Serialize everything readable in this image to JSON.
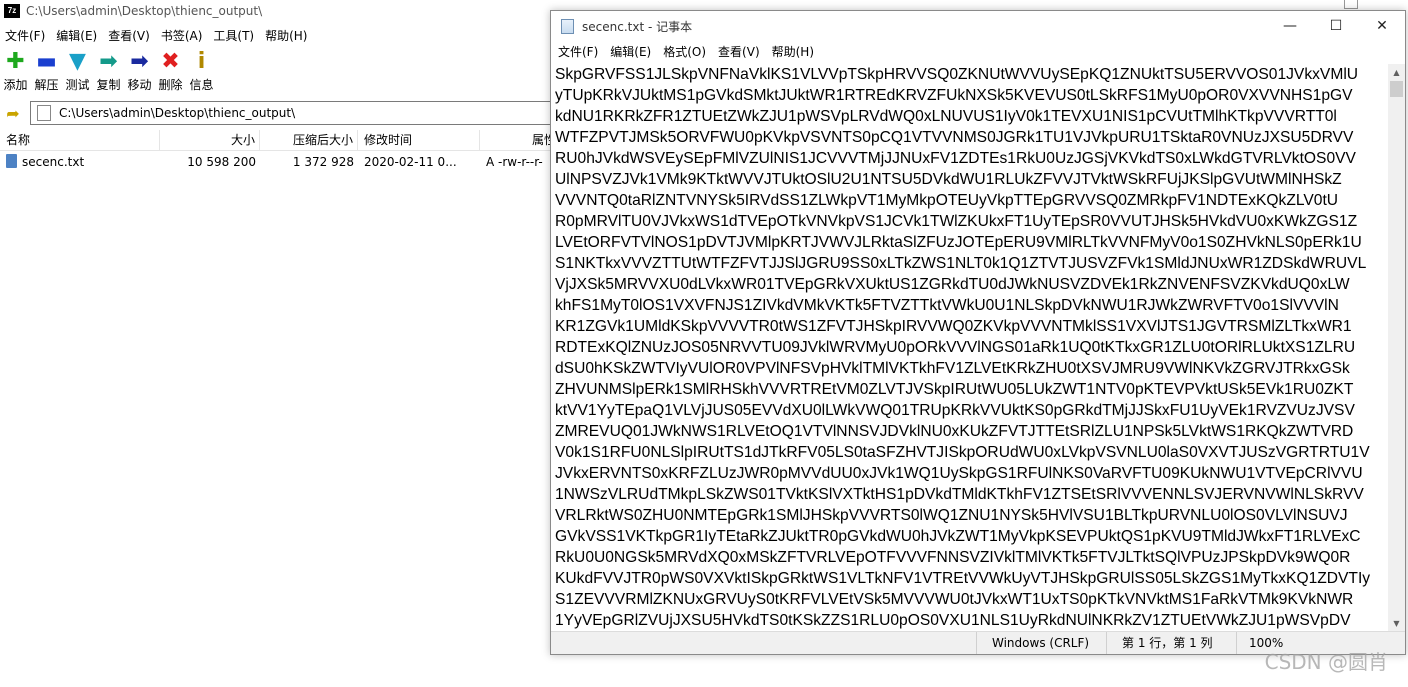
{
  "sevenzip": {
    "title": "C:\\Users\\admin\\Desktop\\thienc_output\\",
    "menu": [
      "文件(F)",
      "编辑(E)",
      "查看(V)",
      "书签(A)",
      "工具(T)",
      "帮助(H)"
    ],
    "toolbar": [
      {
        "label": "添加",
        "icon": "add-icon",
        "glyph": "✚",
        "color": "#1ea81e"
      },
      {
        "label": "解压",
        "icon": "extract-icon",
        "glyph": "▬",
        "color": "#1a3fcf"
      },
      {
        "label": "测试",
        "icon": "test-icon",
        "glyph": "▼",
        "color": "#1aa0c8"
      },
      {
        "label": "复制",
        "icon": "copy-icon",
        "glyph": "➡",
        "color": "#149a8a"
      },
      {
        "label": "移动",
        "icon": "move-icon",
        "glyph": "➡",
        "color": "#1a2a9f"
      },
      {
        "label": "删除",
        "icon": "delete-icon",
        "glyph": "✖",
        "color": "#e02020"
      },
      {
        "label": "信息",
        "icon": "info-icon",
        "glyph": "i",
        "color": "#b08800"
      }
    ],
    "address": "C:\\Users\\admin\\Desktop\\thienc_output\\",
    "columns": [
      "名称",
      "大小",
      "压缩后大小",
      "修改时间",
      "属性"
    ],
    "file": {
      "name": "secenc.txt",
      "size": "10 598 200",
      "packed": "1 372 928",
      "modified": "2020-02-11 0...",
      "attributes": "A -rw-r--r-"
    }
  },
  "notepad": {
    "title": "secenc.txt - 记事本",
    "menu": [
      "文件(F)",
      "编辑(E)",
      "格式(O)",
      "查看(V)",
      "帮助(H)"
    ],
    "lines": [
      "SkpGRVFSS1JLSkpVNFNaVklKS1VLVVpTSkpHRVVSQ0ZKNUtWVVUySEpKQ1ZNUktTSU5ERVVOS01JVkxVMlU",
      "yTUpKRkVJUktMS1pGVkdSMktJUktWR1RTREdKRVZFUkNXSk5KVEVUS0tLSkRFS1MyU0pOR0VXVVNHS1pGV",
      "kdNU1RKRkZFR1ZTUEtZWkZJU1pWSVpLRVdWQ0xLNUVUS1IyV0k1TEVXU1NIS1pCVUtTMlhKTkpVVVRTT0l",
      "WTFZPVTJMSk5ORVFWU0pKVkpVSVNTS0pCQ1VTVVNMS0JGRk1TU1VJVkpURU1TSktaR0VNUzJXSU5DRVV",
      "RU0hJVkdWSVEySEpFMlVZUlNIS1JCVVVTMjJJNUxFV1ZDTEs1RkU0UzJGSjVKVkdTS0xLWkdGTVRLVktOS0VV",
      "UlNPSVZJVk1VMk9KTktWVVJTUktOSlU2U1NTSU5DVkdWU1RLUkZFVVJTVktWSkRFUjJKSlpGVUtWMlNHSkZ",
      "VVVNTQ0taRlZNTVNYSk5IRVdSS1ZLWkpVT1MyMkpOTEUyVkpTTEpGRVVSQ0ZMRkpFV1NDTExKQkZLV0tU",
      "R0pMRVlTU0VJVkxWS1dTVEpOTkVNVkpVS1JCVk1TWlZKUkxFT1UyTEpSR0VVUTJHSk5HVkdVU0xKWkZGS1Z",
      "LVEtORFVTVlNOS1pDVTJVMlpKRTJVWVJLRktaSlZFUzJOTEpERU9VMlRLTkVVNFMyV0o1S0ZHVkNLS0pERk1U",
      "S1NKTkxVVVZTTUtWTFZFVTJJSlJGRU9SS0xLTkZWS1NLT0k1Q1ZTVTJUSVZFVk1SMldJNUxWR1ZDSkdWRUVL",
      "VjJXSk5MRVVXU0dLVkxWR01TVEpGRkVXUktUS1ZGRkdTU0dJWkNUSVZDVEk1RkZNVENFSVZKVkdUQ0xLW",
      "khFS1MyT0lOS1VXVFNJS1ZIVkdVMkVKTk5FTVZTTktVWkU0U1NLSkpDVkNWU1RJWkZWRVFTV0o1SlVVVlN",
      "KR1ZGVk1UMldKSkpVVVVTR0tWS1ZFVTJHSkpIRVVWQ0ZKVkpVVVNTMklSS1VXVlJTS1JGVTRSMlZLTkxWR1",
      "RDTExKQlZNUzJOS05NRVVTU09JVklWRVMyU0pORkVVVlNGS01aRk1UQ0tKTkxGR1ZLU0tORlRLUktXS1ZLRU",
      "dSU0hKSkZWTVIyVUlOR0VPVlNFSVpHVklTMlVKTkhFV1ZLVEtKRkZHU0tXSVJMRU9VWlNKVkZGRVJTRkxGSk",
      "ZHVUNMSlpERk1SMlRHSkhVVVRTREtVM0ZLVTJVSkpIRUtWU05LUkZWT1NTV0pKTEVPVktUSk5EVk1RU0ZKT",
      "ktVV1YyTEpaQ1VLVjJUS05EVVdXU0lLWkVWQ01TRUpKRkVVUktKS0pGRkdTMjJJSkxFU1UyVEk1RVZVUzJVSV",
      "ZMREVUQ01JWkNWS1RLVEtOQ1VTVlNNSVJDVklNU0xKUkZFVTJTTEtSRlZLU1NPSk5LVktWS1RKQkZWTVRD",
      "V0k1S1RFU0NLSlpIRUtTS1dJTkRFV05LS0taSFZHVTJISkpORUdWU0xLVkpVSVNLU0laS0VXVTJUSzVGRTRTU1V",
      "JVkxERVNTS0xKRFZLUzJWR0pMVVdUU0xJVk1WQ1UySkpGS1RFUlNKS0VaRVFTU09KUkNWU1VTVEpCRlVVU",
      "1NWSzVLRUdTMkpLSkZWS01TVktKSlVXTktHS1pDVkdTMldKTkhFV1ZTSEtSRlVVVENNLSVJERVNVWlNLSkRVV",
      "VRLRktWS0ZHU0NMTEpGRk1SMlJHSkpVVVRTS0lWQ1ZNU1NYSk5HVlVSU1BLTkpURVNLU0lOS0VLVlNSUVJ",
      "GVkVSS1VKTkpGR1IyTEtaRkZJUktTR0pGVkdWU0hJVkZWT1MyVkpKSEVPUktQS1pKVU9TMldJWkxFT1RLVExC",
      "RkU0U0NGSk5MRVdXQ0xMSkZFTVRLVEpOTFVVVFNNSVZIVklTMlVKTk5FTVJLTktSQlVPUzJPSkpDVk9WQ0R",
      "KUkdFVVJTR0pWS0VXVktISkpGRktWS1VLTkNFV1VTREtVVWkUyVTJHSkpGRUlSS05LSkZGS1MyTkxKQ1ZDVTIy",
      "S1ZEVVVRMlZKNUxGRVUyS0tKRFVLVEtVSk5MVVVWU0tJVkxWT1UxTS0pKTkVNVktMS1FaRkVTMk9KVkNWR",
      "1YyVEpGRlZVUjJXSU5HVkdTS0tKSkZZS1RLU0pOS0VXU1NLS1UyRkdNUlNKRkZV1ZTUEtVWkZJU1pWSVpDV"
    ],
    "status": {
      "encoding": "Windows (CRLF)",
      "position": "第 1 行，第 1 列",
      "zoom": "100%"
    }
  },
  "watermark": "CSDN @圆肖"
}
